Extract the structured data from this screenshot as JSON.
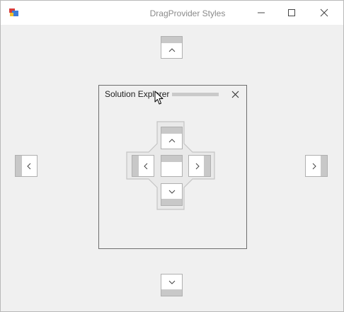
{
  "window": {
    "title": "DragProvider Styles"
  },
  "panel": {
    "title": "Solution Explorer"
  },
  "icons": {
    "app": "app-icon",
    "minimize": "minimize-icon",
    "maximize": "maximize-icon",
    "close": "close-icon",
    "cursor": "mouse-cursor-icon"
  }
}
